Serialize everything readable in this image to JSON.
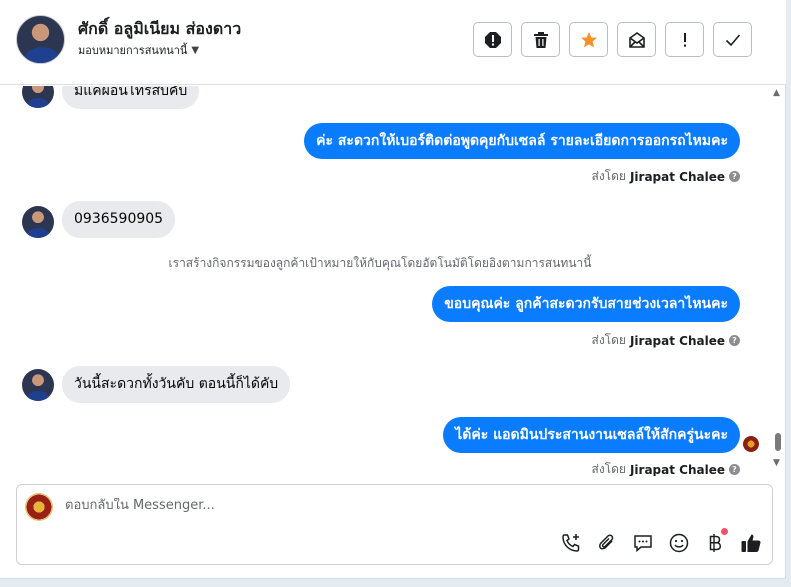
{
  "header": {
    "contact_name": "ศักดิ์ อลูมิเนียม ส่องดาว",
    "assign_label": "มอบหมายการสนทนานี้",
    "toolbar": [
      {
        "icon": "alert-octagon-icon"
      },
      {
        "icon": "trash-icon"
      },
      {
        "icon": "star-icon",
        "color": "#f5902a"
      },
      {
        "icon": "mail-icon"
      },
      {
        "icon": "exclamation-icon"
      },
      {
        "icon": "checkmark-icon"
      }
    ]
  },
  "messages": [
    {
      "type": "in",
      "text": "มิแคผ่อนไทรสบคับ"
    },
    {
      "type": "out",
      "text": "ค่ะ สะดวกให้เบอร์ติดต่อพูดคุยกับเซลล์ รายละเอียดการออกรถไหมคะ",
      "sent_by_prefix": "ส่งโดย",
      "sent_by_name": "Jirapat Chalee"
    },
    {
      "type": "in",
      "text": "0936590905"
    },
    {
      "type": "system",
      "text": "เราสร้างกิจกรรมของลูกค้าเป้าหมายให้กับคุณโดยอัตโนมัติโดยอิงตามการสนทนานี้"
    },
    {
      "type": "out",
      "text": "ขอบคุณค่ะ ลูกค้าสะดวกรับสายช่วงเวลาไหนคะ",
      "sent_by_prefix": "ส่งโดย",
      "sent_by_name": "Jirapat Chalee"
    },
    {
      "type": "in",
      "text": "วันนี้สะดวกทั้งวันคับ ตอนนี้ก็ได้คับ"
    },
    {
      "type": "out",
      "text": "ได้ค่ะ แอดมินประสานงานเซลล์ให้สักครู่นะคะ",
      "sent_by_prefix": "ส่งโดย",
      "sent_by_name": "Jirapat Chalee"
    }
  ],
  "composer": {
    "placeholder": "ตอบกลับใน Messenger...",
    "actions": [
      "phone-add-icon",
      "paperclip-icon",
      "chat-bubble-icon",
      "smile-icon",
      "baht-icon",
      "thumbs-up-icon"
    ]
  },
  "colors": {
    "outgoing_bubble": "#0a7cff",
    "incoming_bubble": "#e9eaed",
    "notification_dot": "#f25268"
  }
}
